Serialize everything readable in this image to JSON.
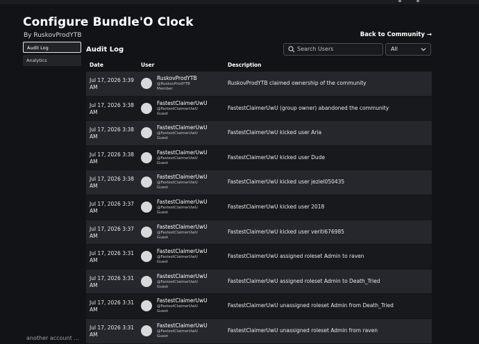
{
  "page": {
    "title": "Configure Bundle'O Clock",
    "byline": "By RuskovProdYTB",
    "back_link": "Back to Community →"
  },
  "sidebar": {
    "items": [
      {
        "label": "Audit Log",
        "active": true
      },
      {
        "label": "Analytics",
        "active": false
      }
    ]
  },
  "audit": {
    "title": "Audit Log",
    "search_placeholder": "Search Users",
    "filter_value": "All",
    "columns": {
      "date": "Date",
      "user": "User",
      "description": "Description"
    },
    "rows": [
      {
        "date": "Jul 17, 2026 3:39 AM",
        "name": "RuskovProdYTB",
        "handle": "@RuskovProdYTB",
        "role": "Member",
        "description": "RuskovProdYTB claimed ownership of the community"
      },
      {
        "date": "Jul 17, 2026 3:38 AM",
        "name": "FastestClaimerUwU",
        "handle": "@FastestClaimerUwU",
        "role": "Guest",
        "description": "FastestClaimerUwU (group owner) abandoned the community"
      },
      {
        "date": "Jul 17, 2026 3:38 AM",
        "name": "FastestClaimerUwU",
        "handle": "@FastestClaimerUwU",
        "role": "Guest",
        "description": "FastestClaimerUwU kicked user Aria"
      },
      {
        "date": "Jul 17, 2026 3:38 AM",
        "name": "FastestClaimerUwU",
        "handle": "@FastestClaimerUwU",
        "role": "Guest",
        "description": "FastestClaimerUwU kicked user Dude"
      },
      {
        "date": "Jul 17, 2026 3:38 AM",
        "name": "FastestClaimerUwU",
        "handle": "@FastestClaimerUwU",
        "role": "Guest",
        "description": "FastestClaimerUwU kicked user jeziel050435"
      },
      {
        "date": "Jul 17, 2026 3:37 AM",
        "name": "FastestClaimerUwU",
        "handle": "@FastestClaimerUwU",
        "role": "Guest",
        "description": "FastestClaimerUwU kicked user 2018"
      },
      {
        "date": "Jul 17, 2026 3:37 AM",
        "name": "FastestClaimerUwU",
        "handle": "@FastestClaimerUwU",
        "role": "Guest",
        "description": "FastestClaimerUwU kicked user veriti676985"
      },
      {
        "date": "Jul 17, 2026 3:31 AM",
        "name": "FastestClaimerUwU",
        "handle": "@FastestClaimerUwU",
        "role": "Guest",
        "description": "FastestClaimerUwU assigned roleset Admin to raven"
      },
      {
        "date": "Jul 17, 2026 3:31 AM",
        "name": "FastestClaimerUwU",
        "handle": "@FastestClaimerUwU",
        "role": "Guest",
        "description": "FastestClaimerUwU assigned roleset Admin to Death_Tried"
      },
      {
        "date": "Jul 17, 2026 3:31 AM",
        "name": "FastestClaimerUwU",
        "handle": "@FastestClaimerUwU",
        "role": "Guest",
        "description": "FastestClaimerUwU unassigned roleset Admin from Death_Tried"
      },
      {
        "date": "Jul 17, 2026 3:31 AM",
        "name": "FastestClaimerUwU",
        "handle": "@FastestClaimerUwU",
        "role": "Guest",
        "description": "FastestClaimerUwU unassigned roleset Admin from raven"
      }
    ]
  },
  "footer_text": "another account ...",
  "colors": {
    "background": "#121316",
    "row_odd": "#25272c",
    "row_even": "#18191c",
    "text": "#e9eaec"
  }
}
